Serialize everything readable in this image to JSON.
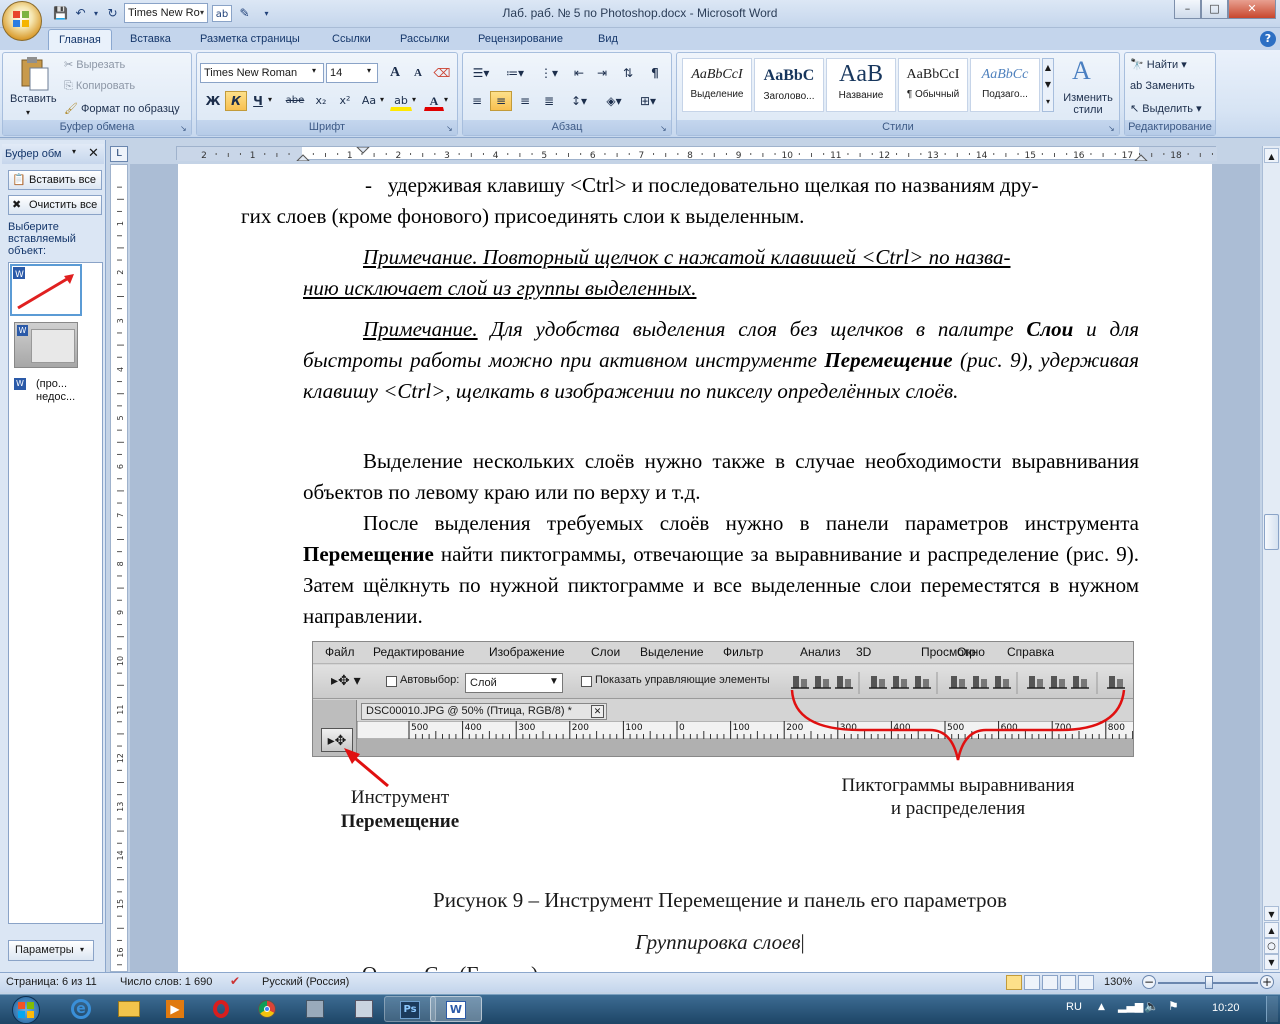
{
  "window": {
    "title": "Лаб. раб. № 5 по Photoshop.docx - Microsoft Word",
    "quick_access_font": "Times New Ro",
    "minimize": "–",
    "maximize": "□",
    "close": "✕"
  },
  "tabs": [
    "Главная",
    "Вставка",
    "Разметка страницы",
    "Ссылки",
    "Рассылки",
    "Рецензирование",
    "Вид"
  ],
  "ribbon": {
    "clipboard": {
      "paste": "Вставить",
      "cut": "Вырезать",
      "copy": "Копировать",
      "format_painter": "Формат по образцу",
      "label": "Буфер обмена"
    },
    "font": {
      "name": "Times New Roman",
      "size": "14",
      "grow": "A",
      "shrink": "A",
      "bold": "Ж",
      "italic": "К",
      "underline": "Ч",
      "strike": "abe",
      "subscript": "x₂",
      "superscript": "x²",
      "case": "Aa",
      "label": "Шрифт"
    },
    "paragraph": {
      "label": "Абзац"
    },
    "styles": {
      "items": [
        {
          "sample": "AaBbCcI",
          "name": "Выделение"
        },
        {
          "sample": "AaBbC",
          "name": "Заголово..."
        },
        {
          "sample": "AaB",
          "name": "Название"
        },
        {
          "sample": "AaBbCcI",
          "name": "¶ Обычный"
        },
        {
          "sample": "AaBbCc",
          "name": "Подзаго..."
        }
      ],
      "change": "Изменить стили",
      "label": "Стили"
    },
    "editing": {
      "find": "Найти",
      "replace": "Заменить",
      "select": "Выделить",
      "label": "Редактирование"
    }
  },
  "pane": {
    "title": "Буфер обм",
    "paste_all": "Вставить все",
    "clear_all": "Очистить все",
    "hint": "Выберите вставляемый объект:",
    "item3": "(про... недос...",
    "params": "Параметры"
  },
  "ruler": {
    "corner": "L"
  },
  "doc": {
    "p1_dash": "-",
    "p1_line1": "удерживая клавишу <Ctrl> и последовательно щелкая по названиям дру-",
    "p1_line2": "гих слоев (кроме фонового) присоединять слои к выделенным.",
    "note1_line1": "Примечание. Повторный щелчок с нажатой клавишей <Ctrl> по назва-",
    "note1_line2": "нию исключает слой из группы выделенных.",
    "note2_label": "Примечание.",
    "note2_a": " Для удобства выделения слоя без щелчков в палитре ",
    "note2_b": "Слои",
    "note2_c": " и для быстроты работы можно при активном инструменте ",
    "note2_d": "Перемещение",
    "note2_e": " (рис. 9), удерживая клавишу <Ctrl>, щелкать в изображении по пикселу определённых слоёв.",
    "p3": "Выделение нескольких слоёв нужно также в случае необходимости выравнивания объектов по левому краю или по верху и т.д.",
    "p4_a": "После выделения требуемых слоёв нужно в панели параметров инструмента ",
    "p4_b": "Перемещение",
    "p4_c": " найти пиктограммы, отвечающие за выравнивание и распределение (рис. 9). Затем щёлкнуть по нужной пиктограмме и все выделенные слои переместятся в нужном направлении.",
    "callout_left_1": "Инструмент",
    "callout_left_2": "Перемещение",
    "callout_right_1": "Пиктограммы выравнивания",
    "callout_right_2": "и распределения",
    "caption": "Рисунок 9 – Инструмент Перемещение и панель его параметров",
    "heading": "Группировка слоев",
    "partial": "О         С    (Г          )"
  },
  "ps": {
    "menu": [
      "Файл",
      "Редактирование",
      "Изображение",
      "Слои",
      "Выделение",
      "Фильтр",
      "Анализ",
      "3D",
      "Просмотр",
      "Окно",
      "Справка"
    ],
    "autoselect": "Автовыбор:",
    "layer_select": "Слой",
    "show_controls": "Показать управляющие элементы",
    "doc_tab": "DSC00010.JPG @ 50% (Птица, RGB/8) *",
    "ruler_ticks": [
      "500",
      "400",
      "300",
      "200",
      "100",
      "0",
      "100",
      "200",
      "300",
      "400",
      "500",
      "600",
      "700",
      "800"
    ]
  },
  "status": {
    "page": "Страница: 6 из 11",
    "words": "Число слов: 1 690",
    "lang": "Русский (Россия)",
    "zoom": "130%"
  },
  "taskbar": {
    "lang": "RU",
    "time": "10:20"
  }
}
